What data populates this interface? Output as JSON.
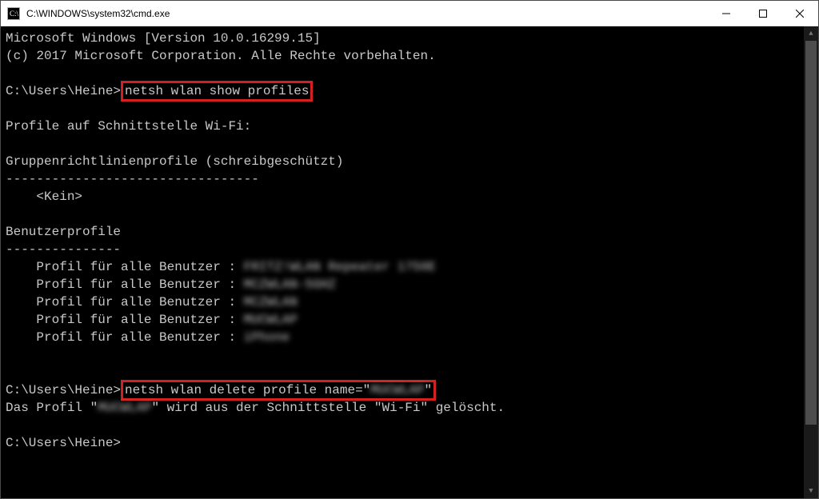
{
  "titlebar": {
    "title": "C:\\WINDOWS\\system32\\cmd.exe"
  },
  "terminal": {
    "banner_line1": "Microsoft Windows [Version 10.0.16299.15]",
    "banner_line2": "(c) 2017 Microsoft Corporation. Alle Rechte vorbehalten.",
    "prompt1_path": "C:\\Users\\Heine>",
    "cmd1": "netsh wlan show profiles",
    "profiles_header": "Profile auf Schnittstelle Wi-Fi:",
    "gp_header": "Gruppenrichtlinienprofile (schreibgeschützt)",
    "gp_sep": "---------------------------------",
    "gp_none": "    <Kein>",
    "user_header": "Benutzerprofile",
    "user_sep": "---------------",
    "profile_label": "    Profil für alle Benutzer : ",
    "profiles": [
      "FRITZ!WLAN Repeater 1750E",
      "MCZWLAN-5GHZ",
      "MCZWLAN",
      "MUCWLAP",
      "iPhone"
    ],
    "prompt2_path": "C:\\Users\\Heine>",
    "cmd2_a": "netsh wlan delete profile name=\"",
    "cmd2_blur": "MUCWLAP",
    "cmd2_b": "\"",
    "del_msg_a": "Das Profil \"",
    "del_msg_blur": "MUCWLAP",
    "del_msg_b": "\" wird aus der Schnittstelle \"Wi-Fi\" gelöscht.",
    "prompt3_path": "C:\\Users\\Heine>"
  }
}
